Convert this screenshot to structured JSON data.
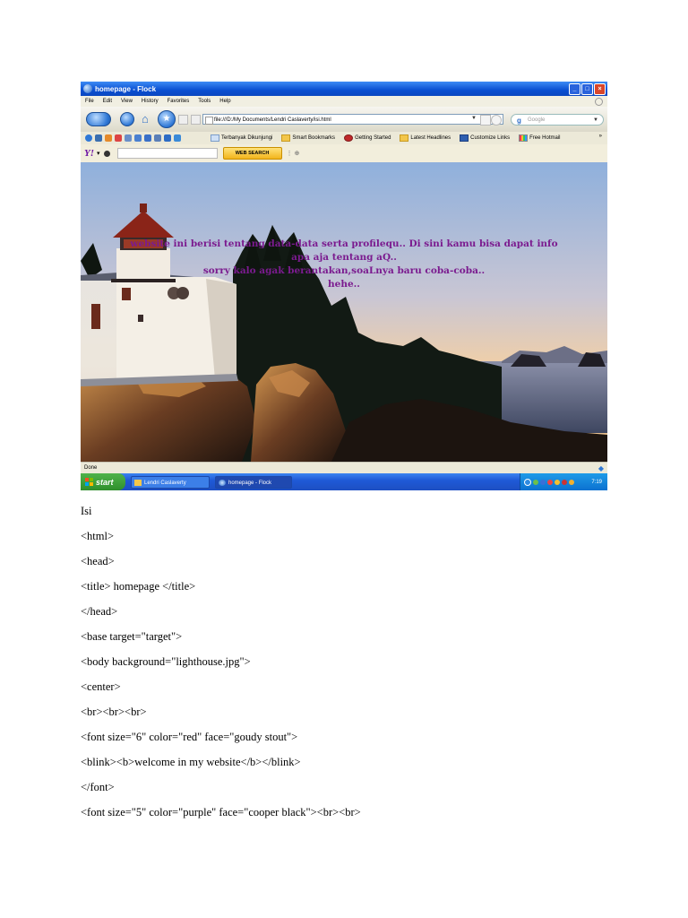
{
  "window": {
    "title": "homepage - Flock",
    "controls": [
      "_",
      "□",
      "×"
    ]
  },
  "menu": [
    "File",
    "Edit",
    "View",
    "History",
    "Favorites",
    "Tools",
    "Help"
  ],
  "address": {
    "url": "file:///D:/My Documents/Lendri Caslaverty/isi.html"
  },
  "search": {
    "engine_icon": "g",
    "placeholder": "Google"
  },
  "bookmarks": [
    {
      "label": "Terbanyak Dikunjungi",
      "icon": "page"
    },
    {
      "label": "Smart Bookmarks",
      "icon": "folder"
    },
    {
      "label": "Getting Started",
      "icon": "flock"
    },
    {
      "label": "Latest Headlines",
      "icon": "folder"
    },
    {
      "label": "Customize Links",
      "icon": "m"
    },
    {
      "label": "Free Hotmail",
      "icon": "msn"
    }
  ],
  "yahoo_toolbar": {
    "logo": "Y!",
    "button": "WEB SEARCH"
  },
  "page": {
    "lines": [
      "website ini berisi tentang data-data serta profilequ.. Di sini kamu bisa dapat info",
      "apa aja tentang aQ..",
      "sorry kalo agak berantakan,soaLnya baru coba-coba..",
      "hehe.."
    ]
  },
  "status": {
    "text": "Done"
  },
  "taskbar": {
    "start": "start",
    "tasks": [
      "Lendri Caslaverty",
      "homepage - Flock"
    ],
    "clock": "7:19"
  },
  "code_lines": [
    "Isi",
    "<html>",
    "<head>",
    "<title> homepage </title>",
    "</head>",
    "<base target=\"target\">",
    "<body background=\"lighthouse.jpg\">",
    "<center>",
    "<br><br><br>",
    "<font size=\"6\" color=\"red\" face=\"goudy stout\">",
    "<blink><b>welcome in my website</b></blink>",
    "</font>",
    "<font size=\"5\" color=\"purple\" face=\"cooper black\"><br><br>"
  ],
  "colors": {
    "overlay_text": "#7b1b8f",
    "titlebar": "#0a4fd1",
    "taskbar": "#1f5ad7",
    "start_button": "#2f8f2c"
  }
}
